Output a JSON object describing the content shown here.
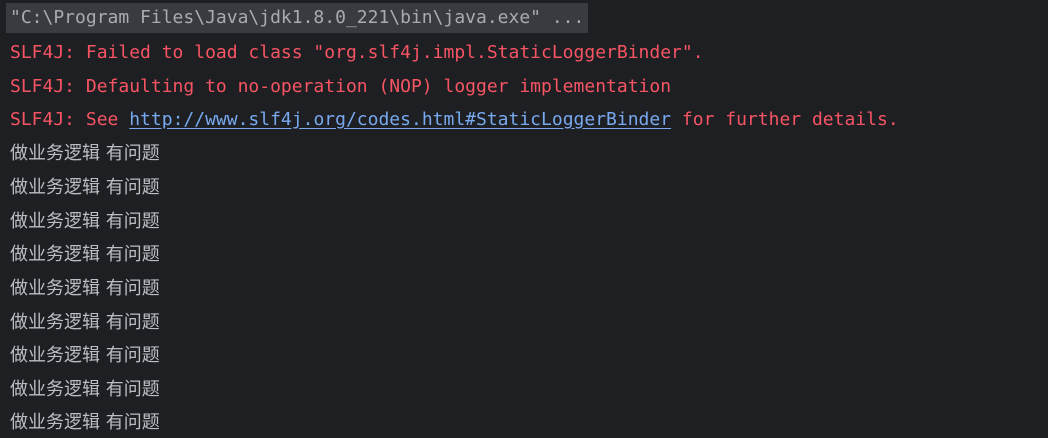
{
  "console": {
    "command": "\"C:\\Program Files\\Java\\jdk1.8.0_221\\bin\\java.exe\" ...",
    "errors": {
      "line1": "SLF4J: Failed to load class \"org.slf4j.impl.StaticLoggerBinder\".",
      "line2": "SLF4J: Defaulting to no-operation (NOP) logger implementation",
      "line3_prefix": "SLF4J: See ",
      "line3_link": "http://www.slf4j.org/codes.html#StaticLoggerBinder",
      "line3_suffix": " for further details."
    },
    "output_lines": [
      "做业务逻辑 有问题",
      "做业务逻辑 有问题",
      "做业务逻辑 有问题",
      "做业务逻辑 有问题",
      "做业务逻辑 有问题",
      "做业务逻辑 有问题",
      "做业务逻辑 有问题",
      "做业务逻辑 有问题",
      "做业务逻辑 有问题"
    ]
  },
  "colors": {
    "background": "#1e1f22",
    "command_highlight": "#393b40",
    "error": "#f75464",
    "link": "#78a9ef",
    "text": "#bcbec4"
  }
}
